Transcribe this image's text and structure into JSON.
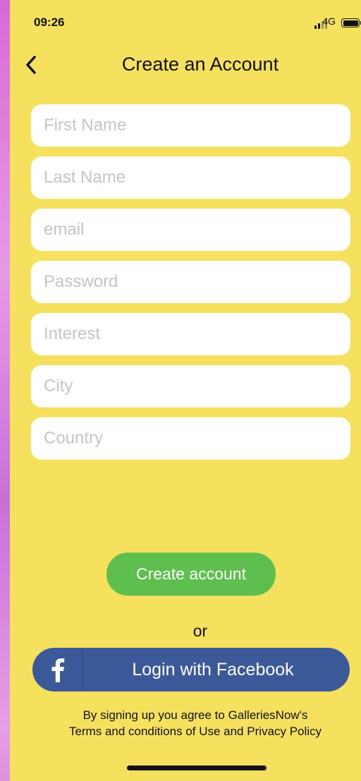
{
  "status_bar": {
    "time": "09:26",
    "network": "4G"
  },
  "header": {
    "title": "Create an Account"
  },
  "form": {
    "fields": [
      {
        "placeholder": "First Name",
        "value": ""
      },
      {
        "placeholder": "Last Name",
        "value": ""
      },
      {
        "placeholder": "email",
        "value": ""
      },
      {
        "placeholder": "Password",
        "value": ""
      },
      {
        "placeholder": "Interest",
        "value": ""
      },
      {
        "placeholder": "City",
        "value": ""
      },
      {
        "placeholder": "Country",
        "value": ""
      }
    ]
  },
  "actions": {
    "create_label": "Create account",
    "or_label": "or",
    "facebook_label": "Login with Facebook"
  },
  "legal": {
    "line1": "By signing up you agree to GalleriesNow's",
    "line2": "Terms and conditions of Use and Privacy Policy"
  },
  "colors": {
    "background": "#f6e15f",
    "create_button": "#5fbf4e",
    "facebook_button": "#3b5998"
  },
  "icons": {
    "back": "chevron-left-icon",
    "facebook": "facebook-icon"
  }
}
